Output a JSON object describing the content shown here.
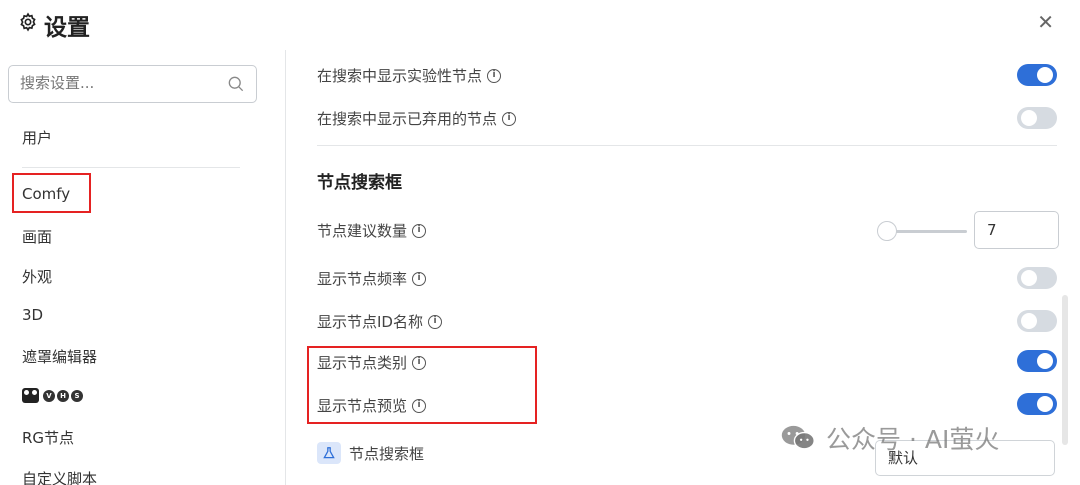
{
  "header": {
    "title": "设置",
    "close_glyph": "✕",
    "icons": [
      "gear-icon",
      "close-icon"
    ]
  },
  "sidebar": {
    "search_placeholder": "搜索设置...",
    "items": [
      "用户",
      "Comfy",
      "画面",
      "外观",
      "3D",
      "遮罩编辑器",
      "VHS",
      "RG节点",
      "自定义脚本"
    ],
    "vhs_letters": [
      "V",
      "H",
      "S"
    ]
  },
  "main": {
    "rows_top": [
      {
        "label": "在搜索中显示实验性节点",
        "toggle": true
      },
      {
        "label": "在搜索中显示已弃用的节点",
        "toggle": false
      }
    ],
    "section_title": "节点搜索框",
    "suggestion_count": {
      "label": "节点建议数量",
      "value": "7"
    },
    "rows": [
      {
        "label": "显示节点频率",
        "toggle": false
      },
      {
        "label": "显示节点ID名称",
        "toggle": false
      },
      {
        "label": "显示节点类别",
        "toggle": true
      },
      {
        "label": "显示节点预览",
        "toggle": true
      }
    ],
    "tag_label": "节点搜索框",
    "select_value": "默认",
    "info_glyph": "i"
  },
  "watermark": {
    "text": "公众号 · AI萤火"
  },
  "colors": {
    "accent": "#2e6fd8",
    "toggle_off": "#d6dbe1",
    "highlight": "#e52222"
  }
}
